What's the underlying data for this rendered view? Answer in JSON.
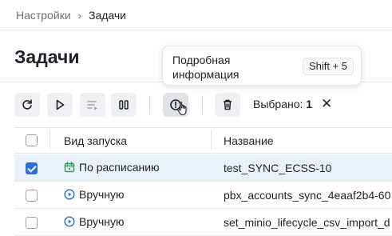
{
  "breadcrumb": {
    "parent": "Настройки",
    "separator": "›",
    "current": "Задачи"
  },
  "page": {
    "title": "Задачи"
  },
  "tooltip": {
    "text": "Подробная информация",
    "shortcut": "Shift + 5"
  },
  "toolbar": {
    "selected_label": "Выбрано:",
    "selected_count": "1",
    "clear": "✕",
    "buttons": [
      "refresh-icon",
      "play-icon",
      "queue-icon",
      "pause-icon",
      "info-icon",
      "trash-icon"
    ]
  },
  "table": {
    "columns": [
      "Вид запуска",
      "Название"
    ],
    "rows": [
      {
        "type": "По расписанию",
        "type_icon": "calendar-icon",
        "name": "test_SYNC_ECSS-10",
        "selected": true
      },
      {
        "type": "Вручную",
        "type_icon": "play-circle-icon",
        "name": "pbx_accounts_sync_4eaaf2b4-60",
        "selected": false
      },
      {
        "type": "Вручную",
        "type_icon": "play-circle-icon",
        "name": "set_minio_lifecycle_csv_import_d",
        "selected": false
      }
    ]
  },
  "colors": {
    "accent": "#2b6fd6",
    "selected_row": "#eaf1fd",
    "schedule_icon": "#2e9e4f"
  }
}
